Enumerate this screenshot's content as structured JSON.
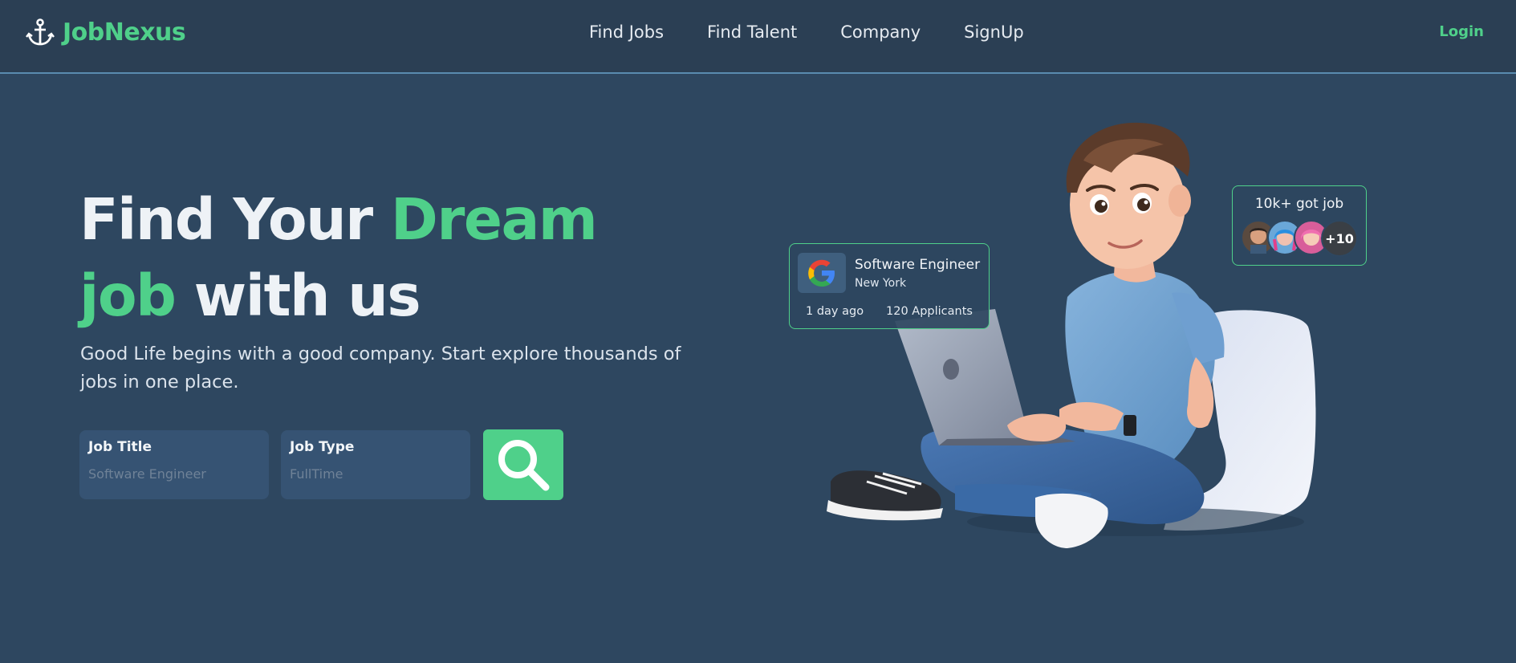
{
  "header": {
    "brand": "JobNexus",
    "nav": [
      "Find Jobs",
      "Find Talent",
      "Company",
      "SignUp"
    ],
    "login_label": "Login"
  },
  "hero": {
    "headline_1a": "Find Your ",
    "headline_1b": "Dream",
    "headline_2a": "job",
    "headline_2b": " with us",
    "subtext": "Good Life begins with a good company. Start explore thousands of jobs in one place."
  },
  "search": {
    "job_title_label": "Job Title",
    "job_title_placeholder": "Software Engineer",
    "job_type_label": "Job Type",
    "job_type_placeholder": "FullTime"
  },
  "job_card": {
    "title": "Software Engineer",
    "location": "New York",
    "posted": "1 day ago",
    "applicants": "120 Applicants"
  },
  "badge": {
    "text": "10k+ got job",
    "more": "+10"
  },
  "colors": {
    "accent": "#4fd08a",
    "background": "#2e4760",
    "header": "#2b3f54"
  }
}
